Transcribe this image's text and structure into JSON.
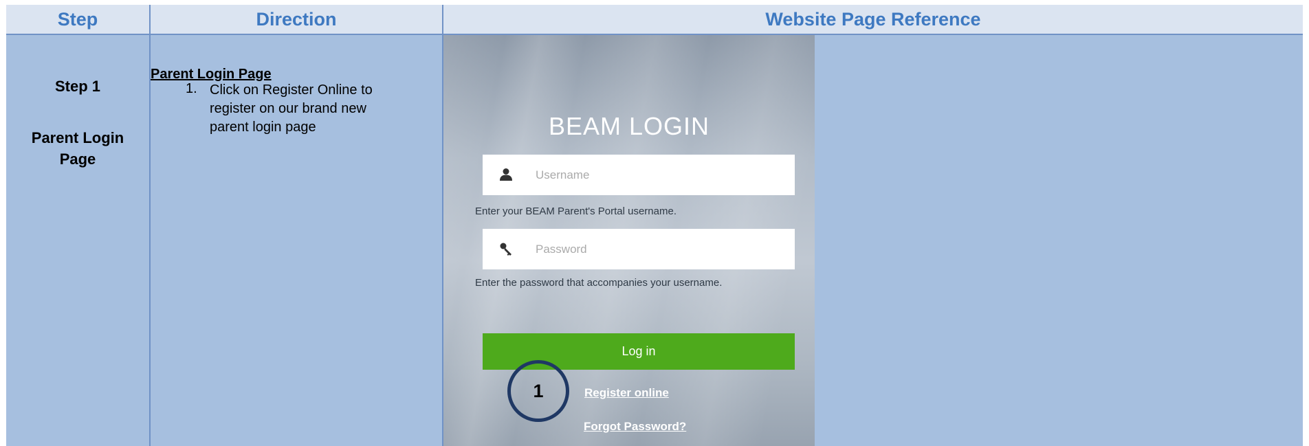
{
  "header": {
    "step": "Step",
    "direction": "Direction",
    "reference": "Website Page Reference"
  },
  "step_cell": {
    "step_label": "Step 1",
    "page_label_line1": "Parent Login",
    "page_label_line2": "Page"
  },
  "direction_cell": {
    "title": "Parent Login Page",
    "item_number": "1.",
    "item_text": "Click on Register Online to register on our brand new parent login page"
  },
  "screenshot": {
    "title": "BEAM LOGIN",
    "username_placeholder": "Username",
    "username_hint": "Enter your BEAM Parent's Portal username.",
    "password_placeholder": "Password",
    "password_hint": "Enter the password that accompanies your username.",
    "login_label": "Log in",
    "register_link": "Register online",
    "forgot_link": "Forgot Password?",
    "callout_number": "1",
    "user_icon": "user-icon",
    "key_icon": "key-icon",
    "login_button_color": "#4eaa1c"
  },
  "colors": {
    "header_text": "#3e79c1",
    "header_bg": "#dbe4f1",
    "body_bg": "#a6bfdf",
    "border": "#7092c6",
    "callout_ring": "#1f3864"
  }
}
